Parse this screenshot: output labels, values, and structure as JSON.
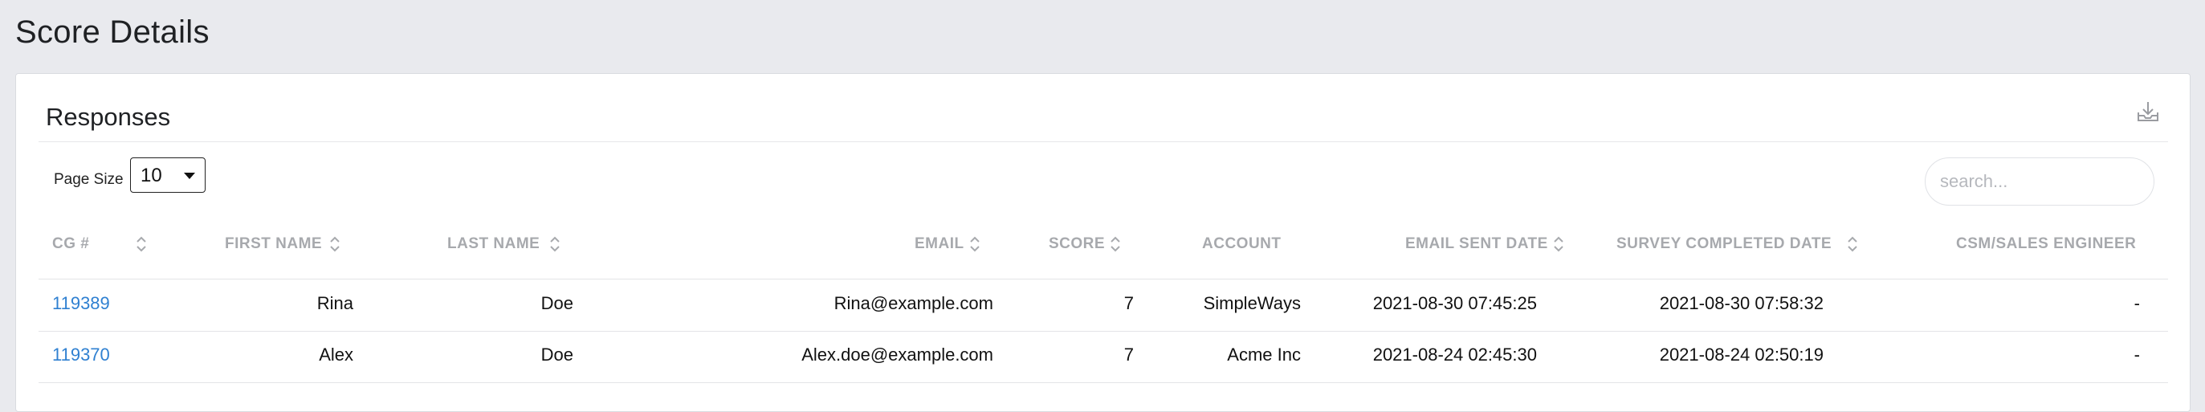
{
  "page": {
    "title": "Score Details"
  },
  "card": {
    "title": "Responses"
  },
  "controls": {
    "page_size_label": "Page Size",
    "page_size_value": "10",
    "search_placeholder": "search..."
  },
  "table": {
    "columns": [
      "CG #",
      "FIRST NAME",
      "LAST NAME",
      "EMAIL",
      "SCORE",
      "ACCOUNT",
      "EMAIL SENT DATE",
      "SURVEY COMPLETED DATE",
      "CSM/SALES ENGINEER"
    ],
    "rows": [
      {
        "cg": "119389",
        "first_name": "Rina",
        "last_name": "Doe",
        "email": "Rina@example.com",
        "score": "7",
        "account": "SimpleWays",
        "email_sent": "2021-08-30 07:45:25",
        "survey_completed": "2021-08-30 07:58:32",
        "csm": "-"
      },
      {
        "cg": "119370",
        "first_name": "Alex",
        "last_name": "Doe",
        "email": "Alex.doe@example.com",
        "score": "7",
        "account": "Acme Inc",
        "email_sent": "2021-08-24 02:45:30",
        "survey_completed": "2021-08-24 02:50:19",
        "csm": "-"
      }
    ]
  },
  "icons": {
    "export": "download-tray-icon",
    "sort": "sort-up-down-icon"
  },
  "colors": {
    "link": "#2f80d1",
    "header_text": "#a7a9ad",
    "background": "#e9eaee"
  }
}
